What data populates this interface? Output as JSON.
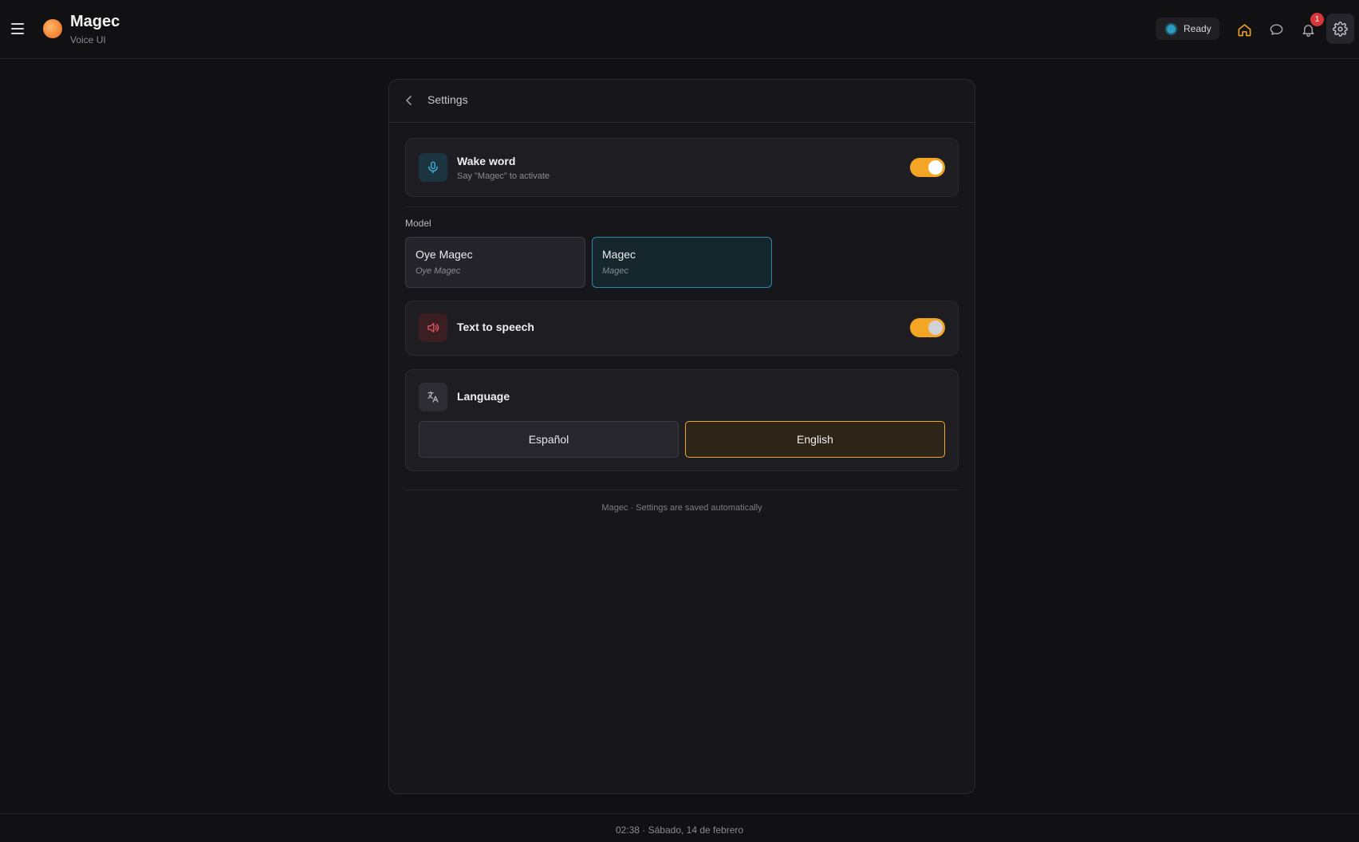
{
  "header": {
    "app_title": "Magec",
    "app_subtitle": "Voice UI",
    "status": "Ready",
    "notification_count": "1",
    "icons": [
      "menu-icon",
      "logo-icon",
      "home-icon",
      "chat-icon",
      "bell-icon",
      "gear-icon"
    ],
    "colors": {
      "accent": "#f5a524",
      "status": "#2a9dbf",
      "badge": "#d8363b"
    }
  },
  "settings": {
    "title": "Settings",
    "wake_word": {
      "title": "Wake word",
      "subtitle": "Say \"Magec\" to activate",
      "enabled": true
    },
    "model": {
      "label": "Model",
      "options": [
        {
          "name": "Oye Magec",
          "alias": "Oye Magec",
          "selected": false
        },
        {
          "name": "Magec",
          "alias": "Magec",
          "selected": true
        }
      ]
    },
    "tts": {
      "title": "Text to speech",
      "enabled": true
    },
    "language": {
      "title": "Language",
      "options": [
        {
          "label": "Español",
          "selected": false
        },
        {
          "label": "English",
          "selected": true
        }
      ]
    },
    "footer": "Magec · Settings are saved automatically"
  },
  "bottom_bar": {
    "clock": "02:38 · Sábado, 14 de febrero"
  }
}
